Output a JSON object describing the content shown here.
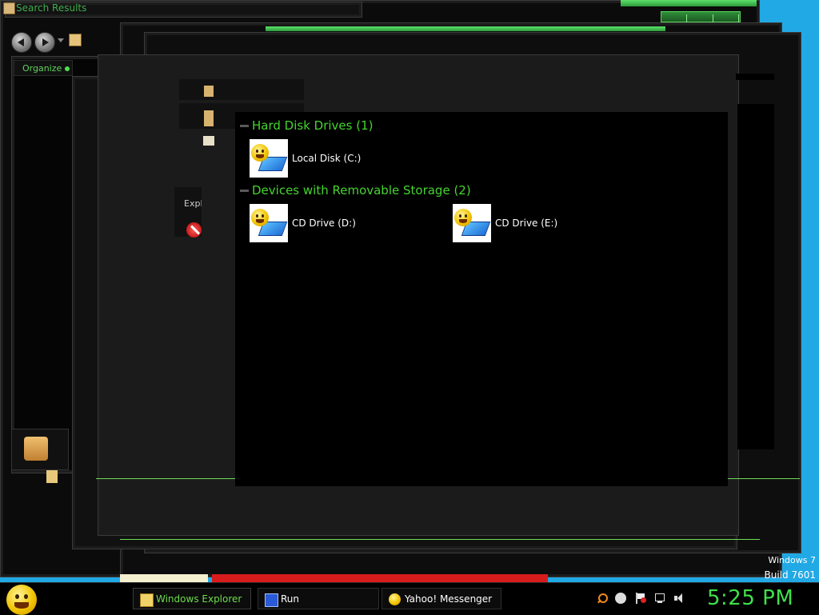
{
  "window": {
    "title": "Search Results",
    "organize_label": "Organize"
  },
  "side_panel": {
    "partial_label": "Expl"
  },
  "groups": [
    {
      "header": "Hard Disk Drives (1)",
      "items": [
        {
          "label": "Local Disk (C:)",
          "icon": "drive-icon"
        }
      ]
    },
    {
      "header": "Devices with Removable Storage (2)",
      "items": [
        {
          "label": "CD Drive (D:)",
          "icon": "drive-icon"
        },
        {
          "label": "CD Drive (E:)",
          "icon": "drive-icon"
        }
      ]
    }
  ],
  "taskbar": {
    "buttons": [
      {
        "label": "Windows Explorer",
        "icon": "folder-icon",
        "active": true
      },
      {
        "label": "Run",
        "icon": "run-icon",
        "active": false
      },
      {
        "label": "Yahoo! Messenger",
        "icon": "smiley-icon",
        "active": false
      }
    ],
    "clock": "5:25 PM"
  },
  "watermark": {
    "line1": "Windows 7",
    "line2": "Build 7601"
  },
  "colors": {
    "accent": "#45d42f",
    "desktop": "#21a9e6",
    "window_bg": "#0b0b0b"
  }
}
